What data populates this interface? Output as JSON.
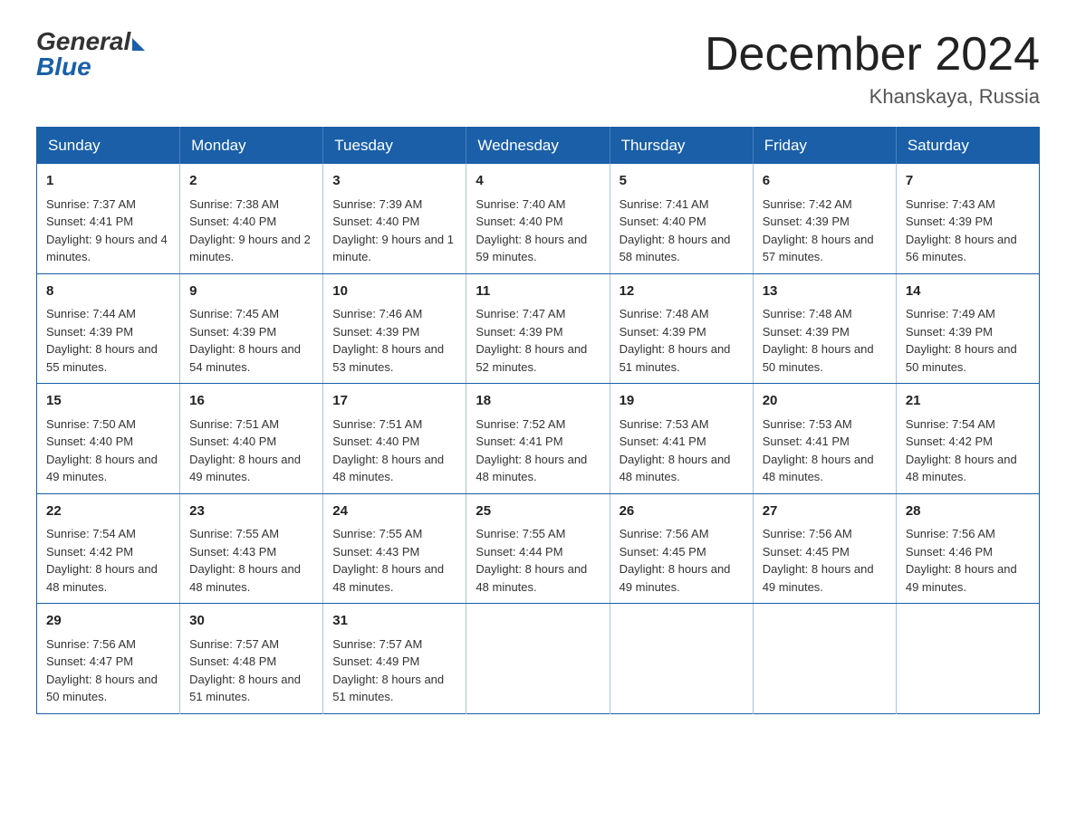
{
  "header": {
    "logo_general": "General",
    "logo_blue": "Blue",
    "month_title": "December 2024",
    "location": "Khanskaya, Russia"
  },
  "days_of_week": [
    "Sunday",
    "Monday",
    "Tuesday",
    "Wednesday",
    "Thursday",
    "Friday",
    "Saturday"
  ],
  "weeks": [
    [
      {
        "day": "1",
        "sunrise": "7:37 AM",
        "sunset": "4:41 PM",
        "daylight": "9 hours and 4 minutes."
      },
      {
        "day": "2",
        "sunrise": "7:38 AM",
        "sunset": "4:40 PM",
        "daylight": "9 hours and 2 minutes."
      },
      {
        "day": "3",
        "sunrise": "7:39 AM",
        "sunset": "4:40 PM",
        "daylight": "9 hours and 1 minute."
      },
      {
        "day": "4",
        "sunrise": "7:40 AM",
        "sunset": "4:40 PM",
        "daylight": "8 hours and 59 minutes."
      },
      {
        "day": "5",
        "sunrise": "7:41 AM",
        "sunset": "4:40 PM",
        "daylight": "8 hours and 58 minutes."
      },
      {
        "day": "6",
        "sunrise": "7:42 AM",
        "sunset": "4:39 PM",
        "daylight": "8 hours and 57 minutes."
      },
      {
        "day": "7",
        "sunrise": "7:43 AM",
        "sunset": "4:39 PM",
        "daylight": "8 hours and 56 minutes."
      }
    ],
    [
      {
        "day": "8",
        "sunrise": "7:44 AM",
        "sunset": "4:39 PM",
        "daylight": "8 hours and 55 minutes."
      },
      {
        "day": "9",
        "sunrise": "7:45 AM",
        "sunset": "4:39 PM",
        "daylight": "8 hours and 54 minutes."
      },
      {
        "day": "10",
        "sunrise": "7:46 AM",
        "sunset": "4:39 PM",
        "daylight": "8 hours and 53 minutes."
      },
      {
        "day": "11",
        "sunrise": "7:47 AM",
        "sunset": "4:39 PM",
        "daylight": "8 hours and 52 minutes."
      },
      {
        "day": "12",
        "sunrise": "7:48 AM",
        "sunset": "4:39 PM",
        "daylight": "8 hours and 51 minutes."
      },
      {
        "day": "13",
        "sunrise": "7:48 AM",
        "sunset": "4:39 PM",
        "daylight": "8 hours and 50 minutes."
      },
      {
        "day": "14",
        "sunrise": "7:49 AM",
        "sunset": "4:39 PM",
        "daylight": "8 hours and 50 minutes."
      }
    ],
    [
      {
        "day": "15",
        "sunrise": "7:50 AM",
        "sunset": "4:40 PM",
        "daylight": "8 hours and 49 minutes."
      },
      {
        "day": "16",
        "sunrise": "7:51 AM",
        "sunset": "4:40 PM",
        "daylight": "8 hours and 49 minutes."
      },
      {
        "day": "17",
        "sunrise": "7:51 AM",
        "sunset": "4:40 PM",
        "daylight": "8 hours and 48 minutes."
      },
      {
        "day": "18",
        "sunrise": "7:52 AM",
        "sunset": "4:41 PM",
        "daylight": "8 hours and 48 minutes."
      },
      {
        "day": "19",
        "sunrise": "7:53 AM",
        "sunset": "4:41 PM",
        "daylight": "8 hours and 48 minutes."
      },
      {
        "day": "20",
        "sunrise": "7:53 AM",
        "sunset": "4:41 PM",
        "daylight": "8 hours and 48 minutes."
      },
      {
        "day": "21",
        "sunrise": "7:54 AM",
        "sunset": "4:42 PM",
        "daylight": "8 hours and 48 minutes."
      }
    ],
    [
      {
        "day": "22",
        "sunrise": "7:54 AM",
        "sunset": "4:42 PM",
        "daylight": "8 hours and 48 minutes."
      },
      {
        "day": "23",
        "sunrise": "7:55 AM",
        "sunset": "4:43 PM",
        "daylight": "8 hours and 48 minutes."
      },
      {
        "day": "24",
        "sunrise": "7:55 AM",
        "sunset": "4:43 PM",
        "daylight": "8 hours and 48 minutes."
      },
      {
        "day": "25",
        "sunrise": "7:55 AM",
        "sunset": "4:44 PM",
        "daylight": "8 hours and 48 minutes."
      },
      {
        "day": "26",
        "sunrise": "7:56 AM",
        "sunset": "4:45 PM",
        "daylight": "8 hours and 49 minutes."
      },
      {
        "day": "27",
        "sunrise": "7:56 AM",
        "sunset": "4:45 PM",
        "daylight": "8 hours and 49 minutes."
      },
      {
        "day": "28",
        "sunrise": "7:56 AM",
        "sunset": "4:46 PM",
        "daylight": "8 hours and 49 minutes."
      }
    ],
    [
      {
        "day": "29",
        "sunrise": "7:56 AM",
        "sunset": "4:47 PM",
        "daylight": "8 hours and 50 minutes."
      },
      {
        "day": "30",
        "sunrise": "7:57 AM",
        "sunset": "4:48 PM",
        "daylight": "8 hours and 51 minutes."
      },
      {
        "day": "31",
        "sunrise": "7:57 AM",
        "sunset": "4:49 PM",
        "daylight": "8 hours and 51 minutes."
      },
      null,
      null,
      null,
      null
    ]
  ],
  "labels": {
    "sunrise": "Sunrise:",
    "sunset": "Sunset:",
    "daylight": "Daylight:"
  }
}
